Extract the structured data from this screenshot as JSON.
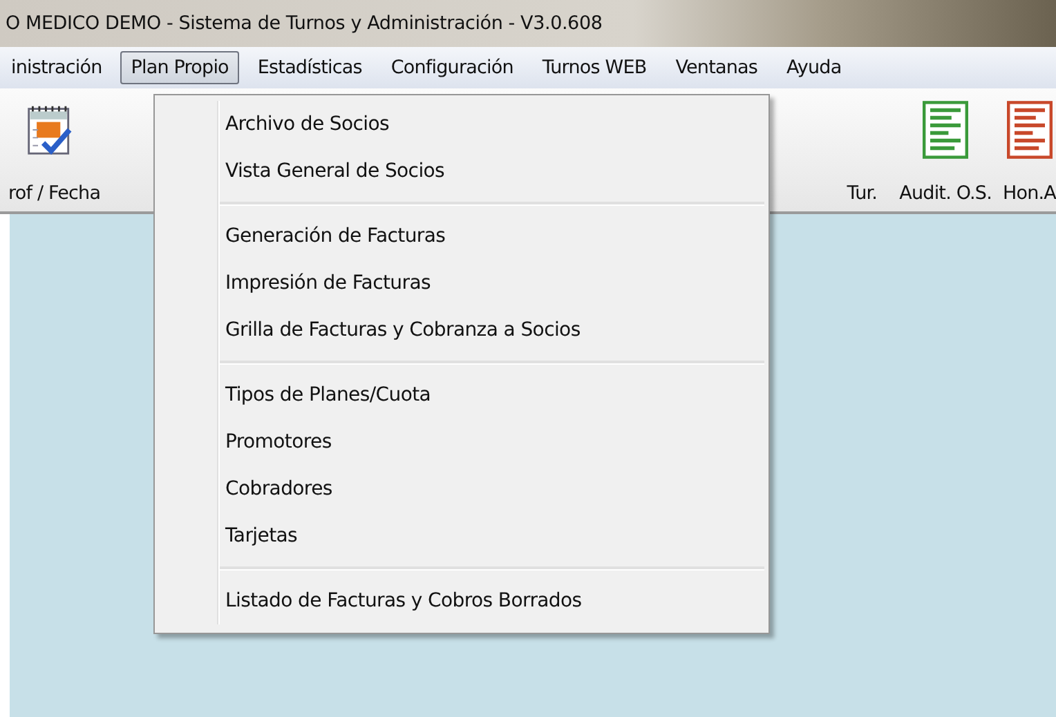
{
  "window": {
    "title": "O MEDICO DEMO - Sistema de Turnos y Administración - V3.0.608"
  },
  "menubar": [
    {
      "label": "inistración",
      "selected": false
    },
    {
      "label": "Plan Propio",
      "selected": true
    },
    {
      "label": "Estadísticas",
      "selected": false
    },
    {
      "label": "Configuración",
      "selected": false
    },
    {
      "label": "Turnos WEB",
      "selected": false
    },
    {
      "label": "Ventanas",
      "selected": false
    },
    {
      "label": "Ayuda",
      "selected": false
    }
  ],
  "toolbar": [
    {
      "label": "rof / Fecha",
      "kind": "calendar"
    },
    {
      "label": "Tur.",
      "kind": "none"
    },
    {
      "label": "Audit. O.S.",
      "kind": "document",
      "color": "#3a9a3a"
    },
    {
      "label": "Hon.A",
      "kind": "document",
      "color": "#c8482a"
    }
  ],
  "dropdown": {
    "groups": [
      {
        "items": [
          "Archivo de Socios",
          "Vista General de Socios"
        ]
      },
      {
        "items": [
          "Generación de Facturas",
          "Impresión de Facturas",
          "Grilla de Facturas y Cobranza a Socios"
        ]
      },
      {
        "items": [
          "Tipos de Planes/Cuota",
          "Promotores",
          "Cobradores",
          "Tarjetas"
        ]
      },
      {
        "items": [
          "Listado de Facturas y Cobros Borrados"
        ]
      }
    ]
  }
}
